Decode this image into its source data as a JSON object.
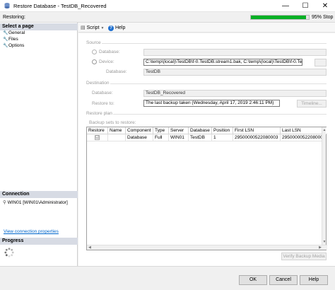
{
  "window": {
    "title": "Restore Database - TestDB_Recovered",
    "minimize": "—",
    "maximize": "☐",
    "close": "✕"
  },
  "status": {
    "label": "Restoring:",
    "progress_percent": 95,
    "percent_text": "95%",
    "stop_label": "Stop",
    "progress_color": "#06b025"
  },
  "left": {
    "select_page_header": "Select a page",
    "pages": [
      "General",
      "Files",
      "Options"
    ],
    "connection_header": "Connection",
    "connection_text": "WIN01 [WIN01\\Administrator]",
    "view_connection_link": "View connection properties",
    "progress_header": "Progress"
  },
  "toolbar": {
    "script_label": "Script",
    "help_label": "Help"
  },
  "source": {
    "group_label": "Source",
    "database_radio_label": "Database:",
    "device_radio_label": "Device:",
    "device_value": "C:\\temp\\(local)\\TestDB\\f-0.TestDB.stream1.bak, C:\\temp\\(local)\\TestDB\\f-0.TestDB...",
    "database_label": "Database:",
    "database_value": "TestDB"
  },
  "destination": {
    "group_label": "Destination",
    "database_label": "Database:",
    "database_value": "TestDB_Recovered",
    "restore_to_label": "Restore to:",
    "restore_to_value": "The last backup taken (Wednesday, April 17, 2019 2:46:11 PM)",
    "timeline_label": "Timeline..."
  },
  "restore_plan": {
    "group_label": "Restore plan",
    "backup_sets_label": "Backup sets to restore:",
    "columns": [
      "Restore",
      "Name",
      "Component",
      "Type",
      "Server",
      "Database",
      "Position",
      "First LSN",
      "Last LSN"
    ],
    "rows": [
      {
        "restore": "☑",
        "name": "",
        "component": "Database",
        "type": "Full",
        "server": "WIN01",
        "database": "TestDB",
        "position": "1",
        "first_lsn": "29500000522080003",
        "last_lsn": "29500000522080001"
      }
    ],
    "verify_label": "Verify Backup Media"
  },
  "buttons": {
    "ok": "OK",
    "cancel": "Cancel",
    "help": "Help"
  }
}
